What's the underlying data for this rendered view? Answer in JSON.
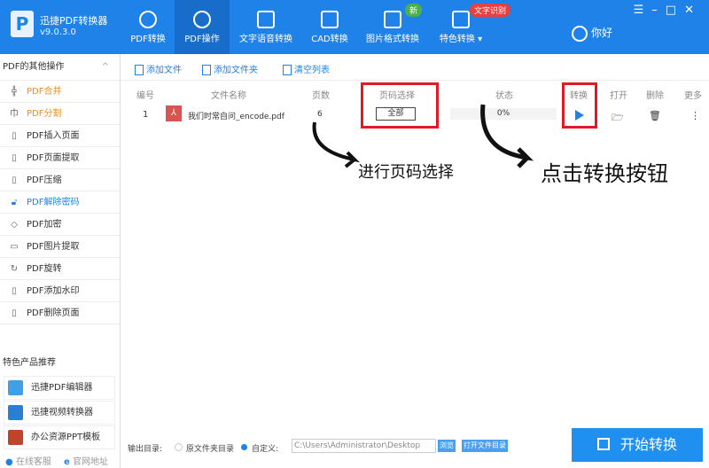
{
  "app": {
    "name": "迅捷PDF转换器",
    "version": "v9.0.3.0",
    "user": "你好"
  },
  "nav": [
    {
      "label": "PDF转换",
      "icon": "pdf-convert-icon"
    },
    {
      "label": "PDF操作",
      "icon": "pdf-operate-icon",
      "active": true
    },
    {
      "label": "文字语音转换",
      "icon": "voice-icon"
    },
    {
      "label": "CAD转换",
      "icon": "cad-icon"
    },
    {
      "label": "图片格式转换",
      "icon": "image-icon",
      "badge": "新"
    },
    {
      "label": "特色转换",
      "icon": "special-icon",
      "badge": "文字识别"
    }
  ],
  "sidebar": {
    "title": "PDF的其他操作",
    "items": [
      "PDF合并",
      "PDF分割",
      "PDF插入页面",
      "PDF页面提取",
      "PDF压缩",
      "PDF解除密码",
      "PDF加密",
      "PDF图片提取",
      "PDF旋转",
      "PDF添加水印",
      "PDF删除页面"
    ],
    "rec_title": "特色产品推荐",
    "products": [
      "迅捷PDF编辑器",
      "迅捷视频转换器",
      "办公资源PPT模板"
    ],
    "footer": [
      "在线客服",
      "官网地址"
    ]
  },
  "toolbar": {
    "add_file": "添加文件",
    "add_folder": "添加文件夹",
    "clear": "清空列表"
  },
  "table": {
    "headers": [
      "编号",
      "文件名称",
      "页数",
      "页码选择",
      "状态",
      "转换",
      "打开",
      "删除",
      "更多"
    ],
    "rows": [
      {
        "no": "1",
        "name": "我们时常自问_encode.pdf",
        "pages": "6",
        "range": "全部",
        "status": "0%",
        "progress": 0
      }
    ]
  },
  "annotations": {
    "range": "进行页码选择",
    "convert": "点击转换按钮"
  },
  "output": {
    "label": "输出目录:",
    "opt1": "原文件夹目录",
    "opt2": "自定义:",
    "path": "C:\\Users\\Administrator\\Desktop",
    "browse": "浏览",
    "open": "打开文件目录"
  },
  "start": "开始转换",
  "colors": {
    "brand": "#1f82e8",
    "highlight": "#e01b24"
  }
}
